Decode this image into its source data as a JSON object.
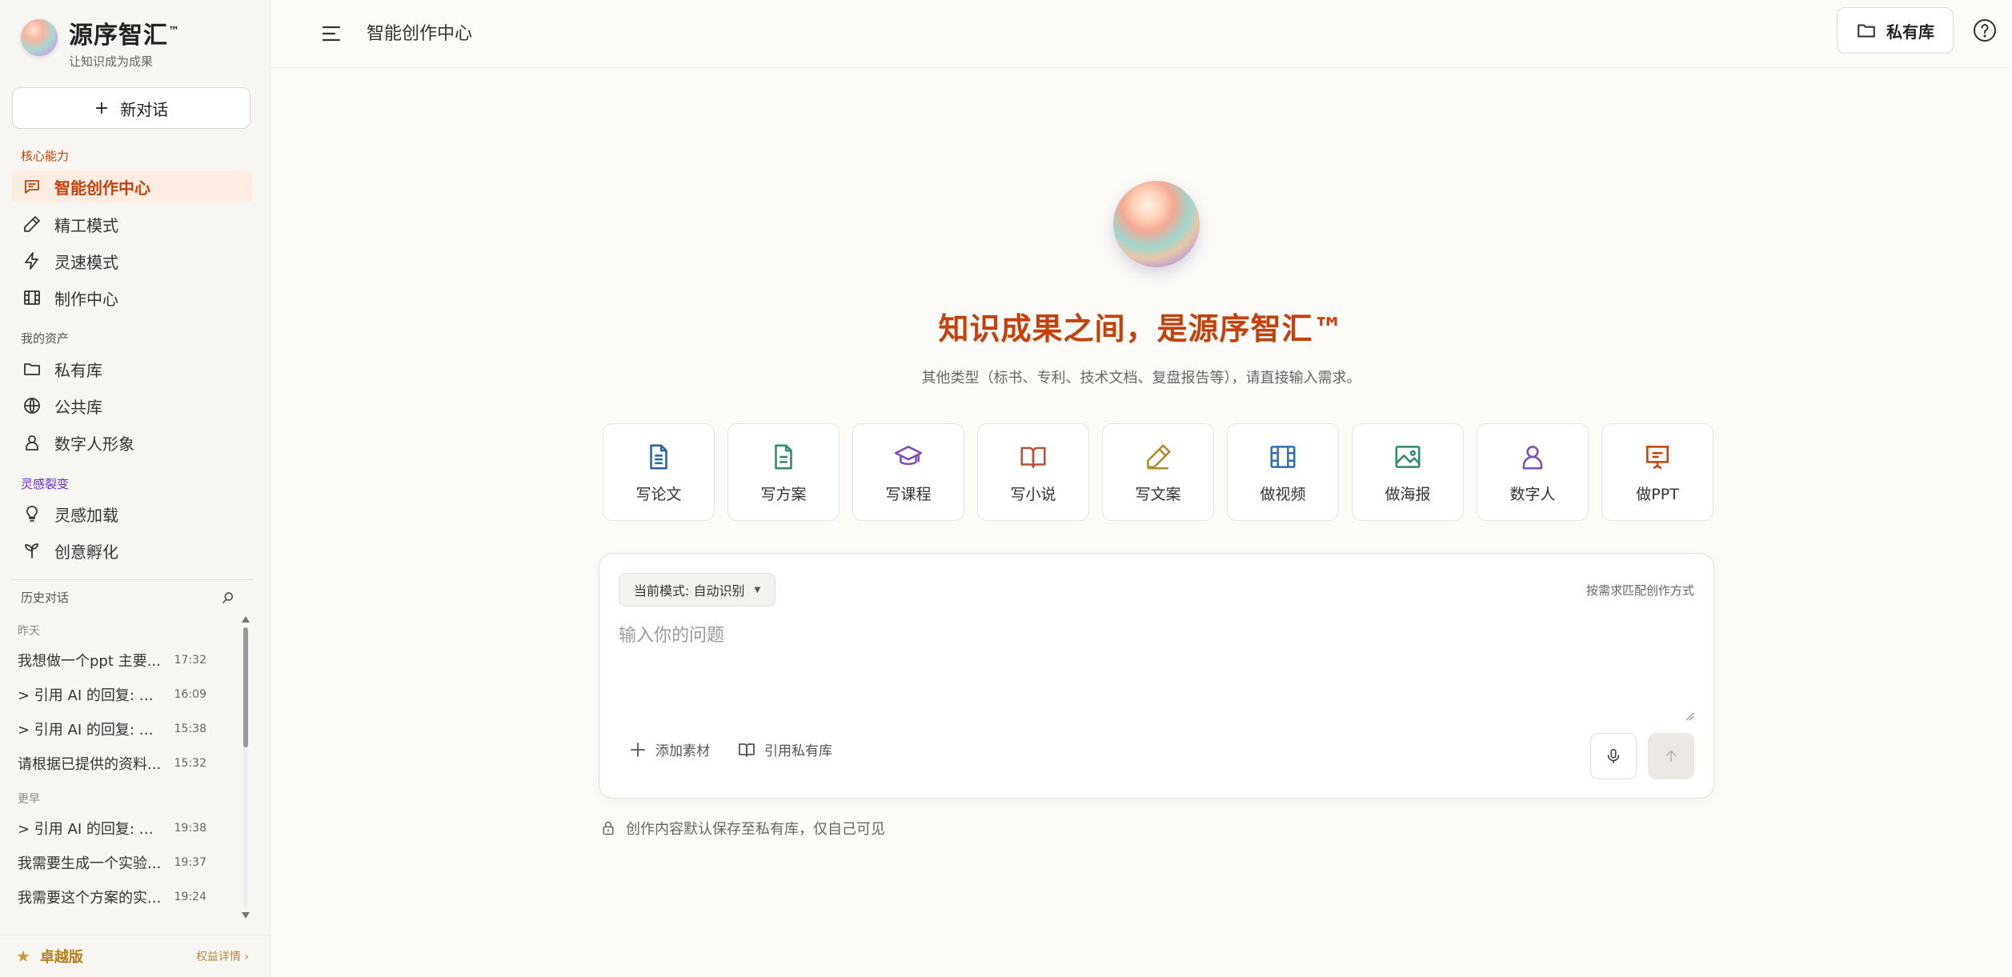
{
  "brand": {
    "name": "源序智汇",
    "tm": "™",
    "slogan": "让知识成为成果"
  },
  "sidebar": {
    "new_chat": "新对话",
    "sections": {
      "core": "核心能力",
      "assets": "我的资产",
      "inspiration": "灵感裂变"
    },
    "core_items": [
      {
        "label": "智能创作中心",
        "icon": "chat-icon",
        "active": true
      },
      {
        "label": "精工模式",
        "icon": "pencil-icon"
      },
      {
        "label": "灵速模式",
        "icon": "lightning-icon"
      },
      {
        "label": "制作中心",
        "icon": "film-icon"
      }
    ],
    "asset_items": [
      {
        "label": "私有库",
        "icon": "folder-icon"
      },
      {
        "label": "公共库",
        "icon": "globe-icon"
      },
      {
        "label": "数字人形象",
        "icon": "user-icon"
      }
    ],
    "inspiration_items": [
      {
        "label": "灵感加载",
        "icon": "lightbulb-icon"
      },
      {
        "label": "创意孵化",
        "icon": "sprout-icon"
      }
    ],
    "history": {
      "title": "历史对话",
      "groups": [
        {
          "label": "昨天",
          "items": [
            {
              "title": "我想做一个ppt 主要...",
              "time": "17:32"
            },
            {
              "title": "> 引用 AI 的回复: >...",
              "time": "16:09"
            },
            {
              "title": "> 引用 AI 的回复: >...",
              "time": "15:38"
            },
            {
              "title": "请根据已提供的资料...",
              "time": "15:32"
            }
          ]
        },
        {
          "label": "更早",
          "items": [
            {
              "title": "> 引用 AI 的回复: >...",
              "time": "19:38"
            },
            {
              "title": "我需要生成一个实验...",
              "time": "19:37"
            },
            {
              "title": "我需要这个方案的实...",
              "time": "19:24"
            }
          ]
        }
      ]
    },
    "tier": {
      "name": "卓越版",
      "link": "权益详情 ›"
    }
  },
  "header": {
    "title": "智能创作中心",
    "private_library": "私有库"
  },
  "hero": {
    "title": "知识成果之间，是源序智汇™",
    "subtitle": "其他类型（标书、专利、技术文档、复盘报告等），请直接输入需求。"
  },
  "cards": [
    {
      "label": "写论文",
      "icon": "document-icon",
      "color": "#2563a8"
    },
    {
      "label": "写方案",
      "icon": "file-lines-icon",
      "color": "#2f8a6a"
    },
    {
      "label": "写课程",
      "icon": "graduation-cap-icon",
      "color": "#7c4dbd"
    },
    {
      "label": "写小说",
      "icon": "open-book-icon",
      "color": "#b4533a"
    },
    {
      "label": "写文案",
      "icon": "pen-icon",
      "color": "#b08a2a"
    },
    {
      "label": "做视频",
      "icon": "film-icon",
      "color": "#2e6fb0"
    },
    {
      "label": "做海报",
      "icon": "image-icon",
      "color": "#2f8a6a"
    },
    {
      "label": "数字人",
      "icon": "person-icon",
      "color": "#7c4dbd"
    },
    {
      "label": "做PPT",
      "icon": "presentation-icon",
      "color": "#c2410c"
    }
  ],
  "composer": {
    "mode_label": "当前模式: 自动识别",
    "match_hint": "按需求匹配创作方式",
    "placeholder": "输入你的问题",
    "value": "",
    "add_material": "添加素材",
    "cite_private": "引用私有库"
  },
  "privacy_note": "创作内容默认保存至私有库，仅自己可见",
  "colors": {
    "accent": "#c2410c",
    "active_bg": "#fdece1",
    "purple": "#6d28d9",
    "gold": "#b57f1e"
  }
}
